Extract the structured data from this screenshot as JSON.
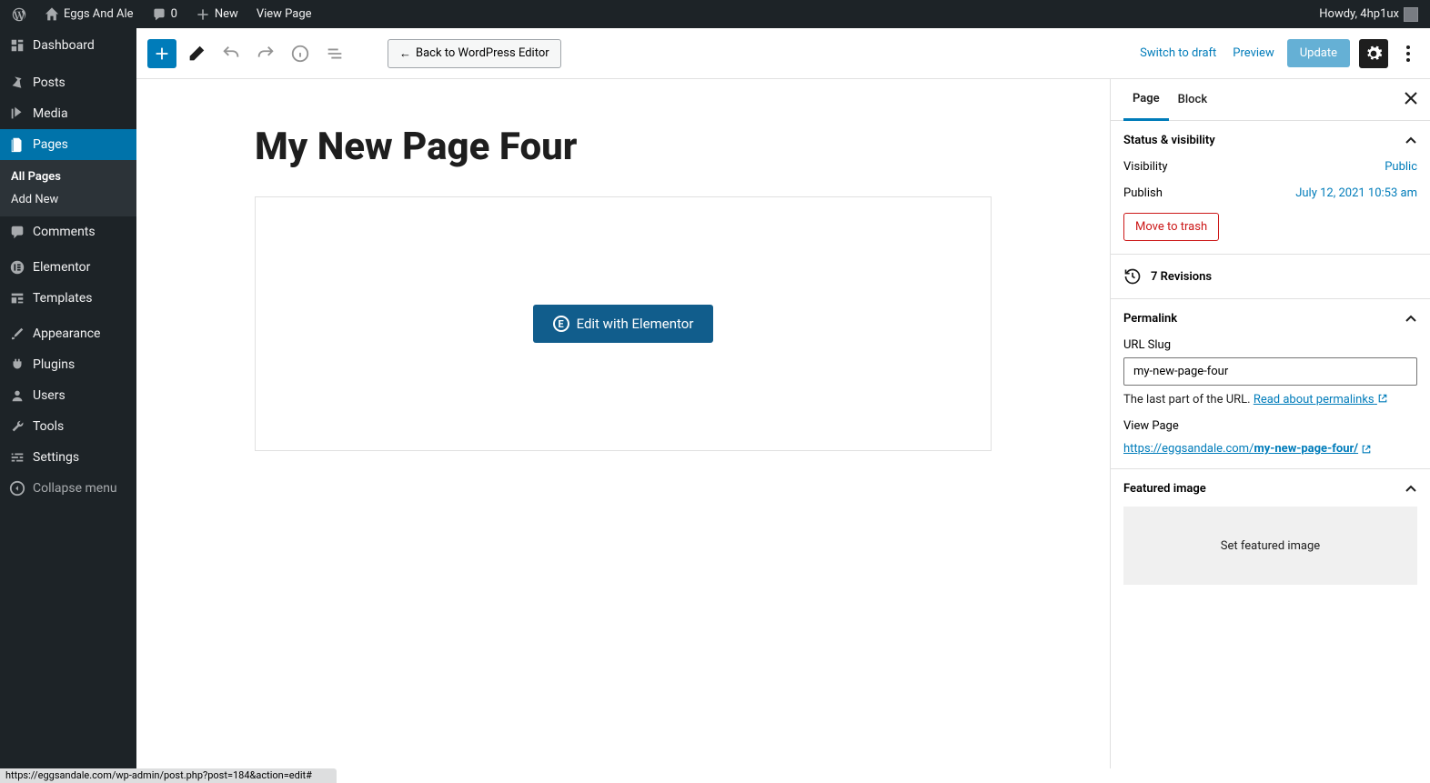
{
  "adminBar": {
    "siteName": "Eggs And Ale",
    "commentCount": "0",
    "newLabel": "New",
    "viewPage": "View Page",
    "howdy": "Howdy, 4hp1ux"
  },
  "sidebar": {
    "dashboard": "Dashboard",
    "posts": "Posts",
    "media": "Media",
    "pages": "Pages",
    "allPages": "All Pages",
    "addNew": "Add New",
    "comments": "Comments",
    "elementor": "Elementor",
    "templates": "Templates",
    "appearance": "Appearance",
    "plugins": "Plugins",
    "users": "Users",
    "tools": "Tools",
    "settings": "Settings",
    "collapse": "Collapse menu"
  },
  "toolbar": {
    "back": "Back to WordPress Editor",
    "switchDraft": "Switch to draft",
    "preview": "Preview",
    "update": "Update"
  },
  "page": {
    "title": "My New Page Four",
    "editElementor": "Edit with Elementor"
  },
  "panel": {
    "tabPage": "Page",
    "tabBlock": "Block",
    "statusHeading": "Status & visibility",
    "visibilityLabel": "Visibility",
    "visibilityValue": "Public",
    "publishLabel": "Publish",
    "publishValue": "July 12, 2021 10:53 am",
    "trash": "Move to trash",
    "revisions": "7 Revisions",
    "permalinkHeading": "Permalink",
    "urlSlugLabel": "URL Slug",
    "urlSlugValue": "my-new-page-four",
    "helpText1": "The last part of the URL. ",
    "helpLink": "Read about permalinks",
    "viewPageLabel": "View Page",
    "permalinkBase": "https://eggsandale.com/",
    "permalinkSlug": "my-new-page-four/",
    "featuredHeading": "Featured image",
    "featuredCta": "Set featured image"
  },
  "statusBar": "https://eggsandale.com/wp-admin/post.php?post=184&action=edit#"
}
